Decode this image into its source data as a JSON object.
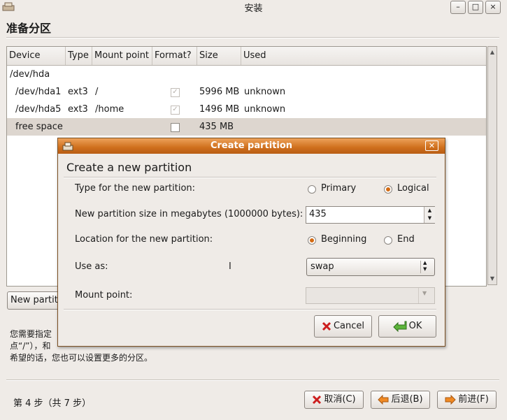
{
  "window": {
    "title": "安装",
    "min_label": "–",
    "max_label": "□",
    "close_label": "×"
  },
  "page_title": "准备分区",
  "table": {
    "columns": [
      "Device",
      "Type",
      "Mount point",
      "Format?",
      "Size",
      "Used"
    ],
    "rows": [
      {
        "device": "/dev/hda",
        "type": "",
        "mount": "",
        "format": "",
        "size": "",
        "used": ""
      },
      {
        "device": "/dev/hda1",
        "type": "ext3",
        "mount": "/",
        "format": "checked",
        "size": "5996 MB",
        "used": "unknown"
      },
      {
        "device": "/dev/hda5",
        "type": "ext3",
        "mount": "/home",
        "format": "checked",
        "size": "1496 MB",
        "used": "unknown"
      },
      {
        "device": "free space",
        "type": "",
        "mount": "",
        "format": "unchecked",
        "size": "435 MB",
        "used": ""
      }
    ]
  },
  "new_partition_button": "New partiti",
  "help": {
    "line1": "您需要指定",
    "line2": "点“/”），和",
    "line3": "希望的话，您也可以设置更多的分区。"
  },
  "footer": {
    "step": "第 4 步（共 7 步）",
    "cancel": "取消(C)",
    "back": "后退(B)",
    "forward": "前进(F)"
  },
  "dialog": {
    "title": "Create partition",
    "heading": "Create a new partition",
    "type_label": "Type for the new partition:",
    "type_primary": "Primary",
    "type_logical": "Logical",
    "type_selected": "Logical",
    "size_label": "New partition size in megabytes (1000000 bytes):",
    "size_value": "435",
    "location_label": "Location for the new partition:",
    "location_beginning": "Beginning",
    "location_end": "End",
    "location_selected": "Beginning",
    "use_as_label": "Use as:",
    "use_as_value": "swap",
    "mount_label": "Mount point:",
    "mount_value": "",
    "cancel": "Cancel",
    "ok": "OK"
  },
  "colors": {
    "accent": "#d46a12",
    "title_bar": "#cf6f1c",
    "window_bg": "#efebe7"
  }
}
